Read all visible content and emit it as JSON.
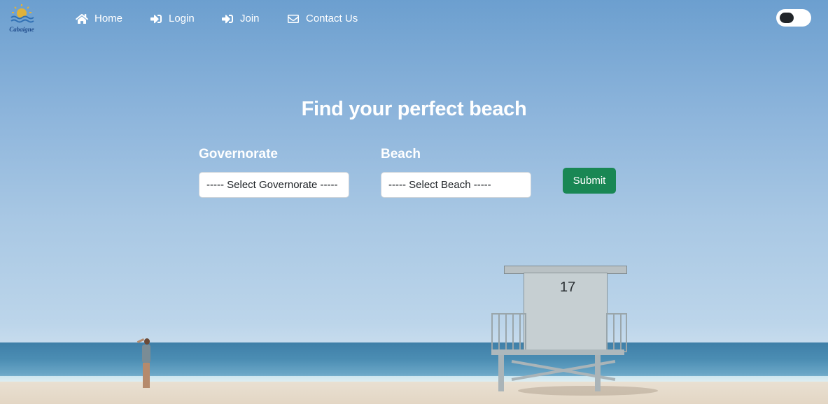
{
  "brand": {
    "logo_text": "Cabaigne",
    "logo_icon": "sun-waves-icon"
  },
  "nav": {
    "items": [
      {
        "label": "Home",
        "icon": "home-icon"
      },
      {
        "label": "Login",
        "icon": "sign-in-icon"
      },
      {
        "label": "Join",
        "icon": "sign-in-icon"
      },
      {
        "label": "Contact Us",
        "icon": "envelope-icon"
      }
    ],
    "theme_toggle": {
      "state": "dark-mode-off"
    }
  },
  "hero": {
    "headline": "Find your perfect beach",
    "governorate": {
      "label": "Governorate",
      "selected": "----- Select Governorate -----"
    },
    "beach": {
      "label": "Beach",
      "selected": "----- Select Beach -----"
    },
    "submit_label": "Submit"
  },
  "scene": {
    "tower_number": "17"
  },
  "colors": {
    "accent": "#198754",
    "nav_text": "#ffffff",
    "logo_blue": "#1f4a8a",
    "logo_gold": "#e0b23a"
  }
}
